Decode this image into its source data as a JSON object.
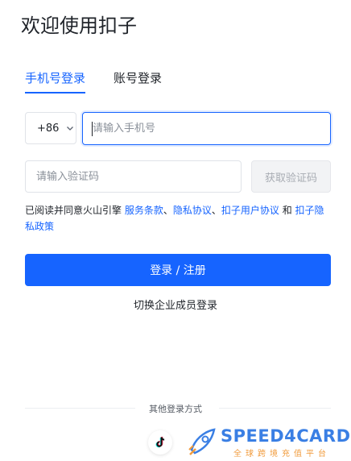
{
  "header": {
    "title": "欢迎使用扣子"
  },
  "tabs": [
    {
      "label": "手机号登录",
      "active": true
    },
    {
      "label": "账号登录",
      "active": false
    }
  ],
  "form": {
    "country_code": "+86",
    "phone_placeholder": "请输入手机号",
    "code_placeholder": "请输入验证码",
    "get_code_label": "获取验证码"
  },
  "agreement": {
    "prefix": "已阅读并同意火山引擎 ",
    "terms": "服务条款",
    "sep1": "、",
    "privacy": "隐私协议",
    "sep2": "、",
    "user_agreement": "扣子用户协议",
    "and": " 和 ",
    "privacy_policy": "扣子隐私政策"
  },
  "actions": {
    "login_label": "登录 / 注册",
    "switch_label": "切换企业成员登录"
  },
  "footer": {
    "other_methods_label": "其他登录方式",
    "tiktok_icon": "tiktok-icon"
  },
  "watermark": {
    "brand": "SPEED4CARD",
    "subtitle": "全球跨境充值平台"
  },
  "colors": {
    "accent": "#1664ff",
    "watermark_blue": "#3a7fe4",
    "watermark_orange": "#f19b3c"
  }
}
